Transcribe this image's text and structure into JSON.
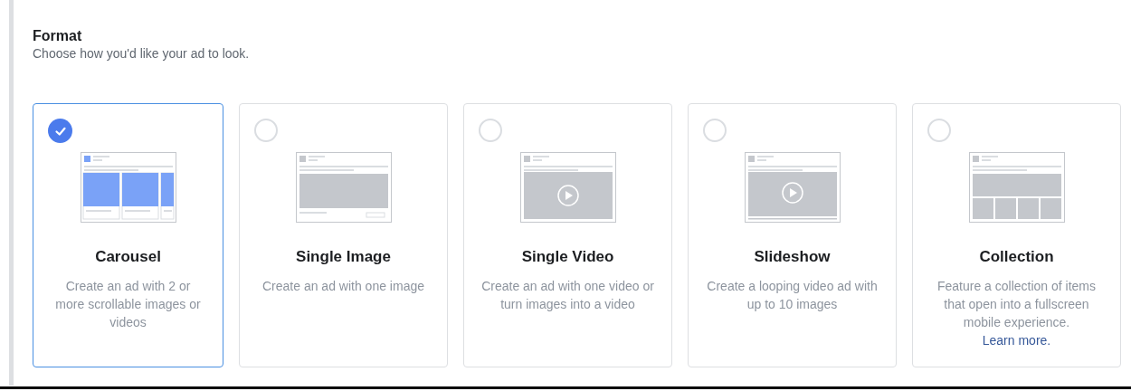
{
  "section": {
    "title": "Format",
    "subtitle": "Choose how you'd like your ad to look."
  },
  "formats": [
    {
      "kind": "carousel",
      "title": "Carousel",
      "description": "Create an ad with 2 or more scrollable images or videos",
      "selected": true
    },
    {
      "kind": "image",
      "title": "Single Image",
      "description": "Create an ad with one image",
      "selected": false
    },
    {
      "kind": "video",
      "title": "Single Video",
      "description": "Create an ad with one video or turn images into a video",
      "selected": false
    },
    {
      "kind": "slideshow",
      "title": "Slideshow",
      "description": "Create a looping video ad with up to 10 images",
      "selected": false
    },
    {
      "kind": "collection",
      "title": "Collection",
      "description": "Feature a collection of items that open into a fullscreen mobile experience.",
      "link": "Learn more.",
      "selected": false
    }
  ]
}
